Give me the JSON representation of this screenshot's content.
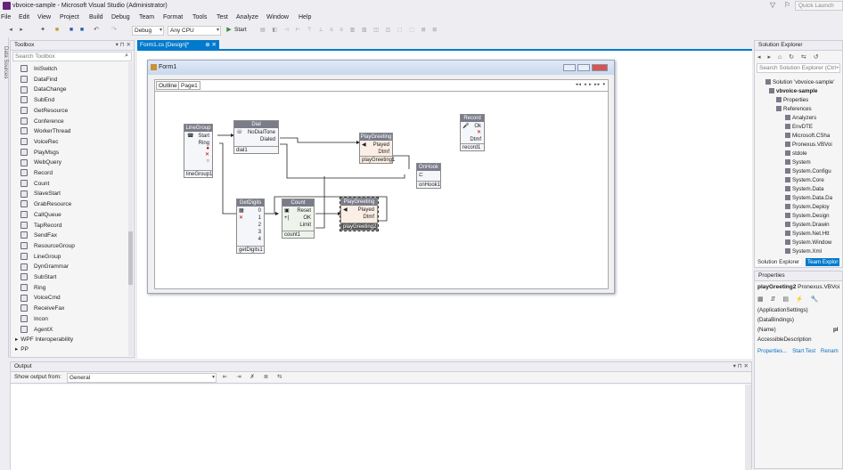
{
  "window": {
    "title": "vbvoice-sample - Microsoft Visual Studio (Administrator)",
    "quick_launch": "Quick Launch"
  },
  "menu": [
    "File",
    "Edit",
    "View",
    "Project",
    "Build",
    "Debug",
    "Team",
    "Format",
    "Tools",
    "Test",
    "Analyze",
    "Window",
    "Help"
  ],
  "toolbar": {
    "config": "Debug",
    "platform": "Any CPU",
    "start": "Start"
  },
  "data_sources_label": "Data Sources",
  "toolbox": {
    "title": "Toolbox",
    "search_placeholder": "Search Toolbox",
    "items": [
      "IniSwitch",
      "DataFind",
      "DataChange",
      "SubEnd",
      "GetResource",
      "Conference",
      "WorkerThread",
      "VoiceRec",
      "PlayMsgs",
      "WebQuery",
      "Record",
      "Count",
      "SlaveStart",
      "GrabResource",
      "CallQueue",
      "TapRecord",
      "SendFax",
      "ResourceGroup",
      "LineGroup",
      "DynGrammar",
      "SubStart",
      "Ring",
      "VoiceCmd",
      "ReceiveFax",
      "Incon",
      "AgentX"
    ],
    "groups": [
      "WPF Interoperability",
      "PP"
    ]
  },
  "document_tab": "Form1.cs [Design]*",
  "form": {
    "title": "Form1",
    "tabs": [
      "Outline",
      "Page1"
    ]
  },
  "blocks": {
    "linegroup": {
      "title": "LineGroup",
      "ports": [
        "Start",
        "Ring"
      ],
      "name": "lineGroup1"
    },
    "dial": {
      "title": "Dial",
      "ports": [
        "NoDialTone",
        "Dialed"
      ],
      "name": "dial1"
    },
    "playgreeting1": {
      "title": "PlayGreeting",
      "ports": [
        "Played",
        "Dtmf"
      ],
      "name": "playGreeting1"
    },
    "record": {
      "title": "Record",
      "ports": [
        "Ok",
        "Dtmf"
      ],
      "name": "record1"
    },
    "onhook": {
      "title": "OnHook",
      "name": "onHook1"
    },
    "getdigits": {
      "title": "GetDigits",
      "ports": [
        "0",
        "1",
        "2",
        "3",
        "4"
      ],
      "name": "getDigits1"
    },
    "count": {
      "title": "Count",
      "ports": [
        "Reset",
        "OK",
        "Limit"
      ],
      "name": "count1"
    },
    "playgreeting2": {
      "title": "PlayGreeting",
      "ports": [
        "Played",
        "Dtmf"
      ],
      "name": "playGreeting2"
    }
  },
  "output": {
    "title": "Output",
    "show_from_label": "Show output from:",
    "source": "General"
  },
  "solution_explorer": {
    "title": "Solution Explorer",
    "search_placeholder": "Search Solution Explorer (Ctrl+",
    "solution": "Solution 'vbvoice-sample'",
    "project": "vbvoice-sample",
    "nodes": [
      "Properties",
      "References"
    ],
    "references": [
      "Analyzers",
      "EnvDTE",
      "Microsoft.CSha",
      "Pronexus.VBVoi",
      "stdole",
      "System",
      "System.Configu",
      "System.Core",
      "System.Data",
      "System.Data.Da",
      "System.Deploy",
      "System.Design",
      "System.Drawin",
      "System.Net.Htt",
      "System.Window",
      "System.Xml"
    ],
    "tabs": [
      "Solution Explorer",
      "Team Explor"
    ]
  },
  "properties": {
    "title": "Properties",
    "object": "playGreeting2",
    "object_type": "Pronexus.VBVoi",
    "rows": [
      {
        "name": "(ApplicationSettings)",
        "value": ""
      },
      {
        "name": "(DataBindings)",
        "value": ""
      },
      {
        "name": "(Name)",
        "value": "pl"
      },
      {
        "name": "AccessibleDescription",
        "value": ""
      }
    ],
    "links": [
      "Properties...",
      "Start Test",
      "Renam"
    ]
  }
}
